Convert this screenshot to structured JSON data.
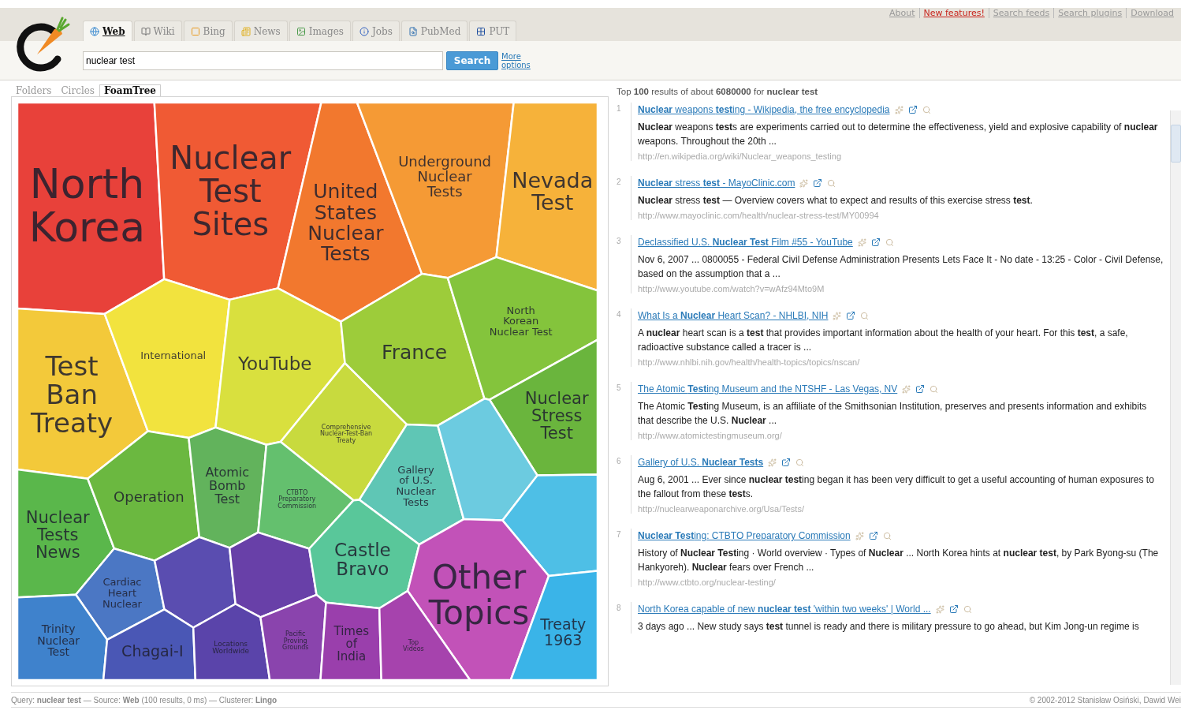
{
  "top_links": [
    {
      "label": "About",
      "featured": false
    },
    {
      "label": "New features!",
      "featured": true
    },
    {
      "label": "Search feeds",
      "featured": false
    },
    {
      "label": "Search plugins",
      "featured": false
    },
    {
      "label": "Download",
      "featured": false
    }
  ],
  "source_tabs": [
    {
      "label": "Web",
      "selected": true
    },
    {
      "label": "Wiki",
      "selected": false
    },
    {
      "label": "Bing",
      "selected": false
    },
    {
      "label": "News",
      "selected": false
    },
    {
      "label": "Images",
      "selected": false
    },
    {
      "label": "Jobs",
      "selected": false
    },
    {
      "label": "PubMed",
      "selected": false
    },
    {
      "label": "PUT",
      "selected": false
    }
  ],
  "search": {
    "value": "nuclear test",
    "button": "Search",
    "more_options": "More options"
  },
  "view_tabs": [
    {
      "label": "Folders",
      "selected": false
    },
    {
      "label": "Circles",
      "selected": false
    },
    {
      "label": "FoamTree",
      "selected": true
    }
  ],
  "foamtree": {
    "cells": [
      {
        "label": "North Korea",
        "color": "#e8413a"
      },
      {
        "label": "Nuclear Test Sites",
        "color": "#f05a34"
      },
      {
        "label": "United States Nuclear Tests",
        "color": "#f2782e"
      },
      {
        "label": "Underground Nuclear Tests",
        "color": "#f59a35"
      },
      {
        "label": "Nevada Test",
        "color": "#f6b23a"
      },
      {
        "label": "Test Ban Treaty",
        "color": "#f3c93a"
      },
      {
        "label": "International",
        "color": "#f2e33e"
      },
      {
        "label": "YouTube",
        "color": "#d9e03e"
      },
      {
        "label": "Comprehensive Nuclear-Test-Ban Treaty",
        "color": "#c8da3e"
      },
      {
        "label": "France",
        "color": "#9dcc3a"
      },
      {
        "label": "North Korean Nuclear Test",
        "color": "#84c43c"
      },
      {
        "label": "Nuclear Stress Test",
        "color": "#6ab53d"
      },
      {
        "label": "Nuclear Tests News",
        "color": "#5ab74b"
      },
      {
        "label": "Operation",
        "color": "#6bb840"
      },
      {
        "label": "Atomic Bomb Test",
        "color": "#62b35c"
      },
      {
        "label": "CTBTO Preparatory Commission",
        "color": "#64c06e"
      },
      {
        "label": "Gallery of U.S. Nuclear Tests",
        "color": "#5fc6b5"
      },
      {
        "color": "#6ccbe0"
      },
      {
        "color": "#4ebfe6"
      },
      {
        "label": "Cardiac Heart Nuclear",
        "color": "#4b77c4"
      },
      {
        "color": "#5a4db0"
      },
      {
        "color": "#6840a8"
      },
      {
        "label": "Castle Bravo",
        "color": "#59c79a"
      },
      {
        "label": "Other Topics",
        "color": "#c252b8"
      },
      {
        "label": "Trinity Nuclear Test",
        "color": "#3f82cc"
      },
      {
        "label": "Chagai-I",
        "color": "#4a57b5"
      },
      {
        "label": "Locations Worldwide",
        "color": "#5a44aa"
      },
      {
        "label": "Pacific Proving Grounds",
        "color": "#8a44ad"
      },
      {
        "label": "Times of India",
        "color": "#9a3fac"
      },
      {
        "label": "Top Videos",
        "color": "#a643ad"
      },
      {
        "label": "Treaty 1963",
        "color": "#3ab4e8"
      }
    ]
  },
  "results_summary": "Top **100** results of about **6080000** for **nuclear test**",
  "results": [
    {
      "number": "1",
      "title": "**Nuclear** weapons **test**ing - Wikipedia, the free encyclopedia",
      "snippet": "**Nuclear** weapons **test**s are experiments carried out to determine the effectiveness, yield and explosive capability of **nuclear** weapons. Throughout the 20th ...",
      "url": "http://en.wikipedia.org/wiki/Nuclear_weapons_testing"
    },
    {
      "number": "2",
      "title": "**Nuclear** stress **test** - MayoClinic.com",
      "snippet": "**Nuclear** stress **test** — Overview covers what to expect and results of this exercise stress **test**.",
      "url": "http://www.mayoclinic.com/health/nuclear-stress-test/MY00994"
    },
    {
      "number": "3",
      "title": "Declassified U.S. **Nuclear Test** Film #55 - YouTube",
      "snippet": "Nov 6, 2007 ... 0800055 - Federal Civil Defense Administration Presents Lets Face It - No date - 13:25 - Color - Civil Defense, based on the assumption that a ...",
      "url": "http://www.youtube.com/watch?v=wAfz94Mto9M"
    },
    {
      "number": "4",
      "title": "What Is a **Nuclear** Heart Scan? - NHLBI, NIH",
      "snippet": "A **nuclear** heart scan is a **test** that provides important information about the health of your heart. For this **test**, a safe, radioactive substance called a tracer is ...",
      "url": "http://www.nhlbi.nih.gov/health/health-topics/topics/nscan/"
    },
    {
      "number": "5",
      "title": "The Atomic **Test**ing Museum and the NTSHF - Las Vegas, NV",
      "snippet": "The Atomic **Test**ing Museum, is an affiliate of the Smithsonian Institution, preserves and presents information and exhibits that describe the U.S. **Nuclear** ...",
      "url": "http://www.atomictestingmuseum.org/"
    },
    {
      "number": "6",
      "title": "Gallery of U.S. **Nuclear Tests**",
      "snippet": "Aug 6, 2001 ... Ever since **nuclear test**ing began it has been very difficult to get a useful accounting of human exposures to the fallout from these **test**s.",
      "url": "http://nuclearweaponarchive.org/Usa/Tests/"
    },
    {
      "number": "7",
      "title": "**Nuclear Test**ing: CTBTO Preparatory Commission",
      "snippet": "History of **Nuclear Test**ing · World overview · Types of **Nuclear** ... North Korea hints at **nuclear test**, by Park Byong-su (The Hankyoreh). **Nuclear** fears over French ...",
      "url": "http://www.ctbto.org/nuclear-testing/"
    },
    {
      "number": "8",
      "title": "North Korea capable of new **nuclear test** 'within two weeks' | World ...",
      "snippet": "3 days ago ... New study says **test** tunnel is ready and there is military pressure to go ahead, but Kim Jong-un regime is"
    }
  ],
  "status_bar": {
    "query": "Query: **nuclear test** — Source: **Web** (100 results, 0 ms) — Clusterer: **Lingo**",
    "copyright": "© 2002-2012 Stanisław Osiński, Dawid Wei"
  }
}
